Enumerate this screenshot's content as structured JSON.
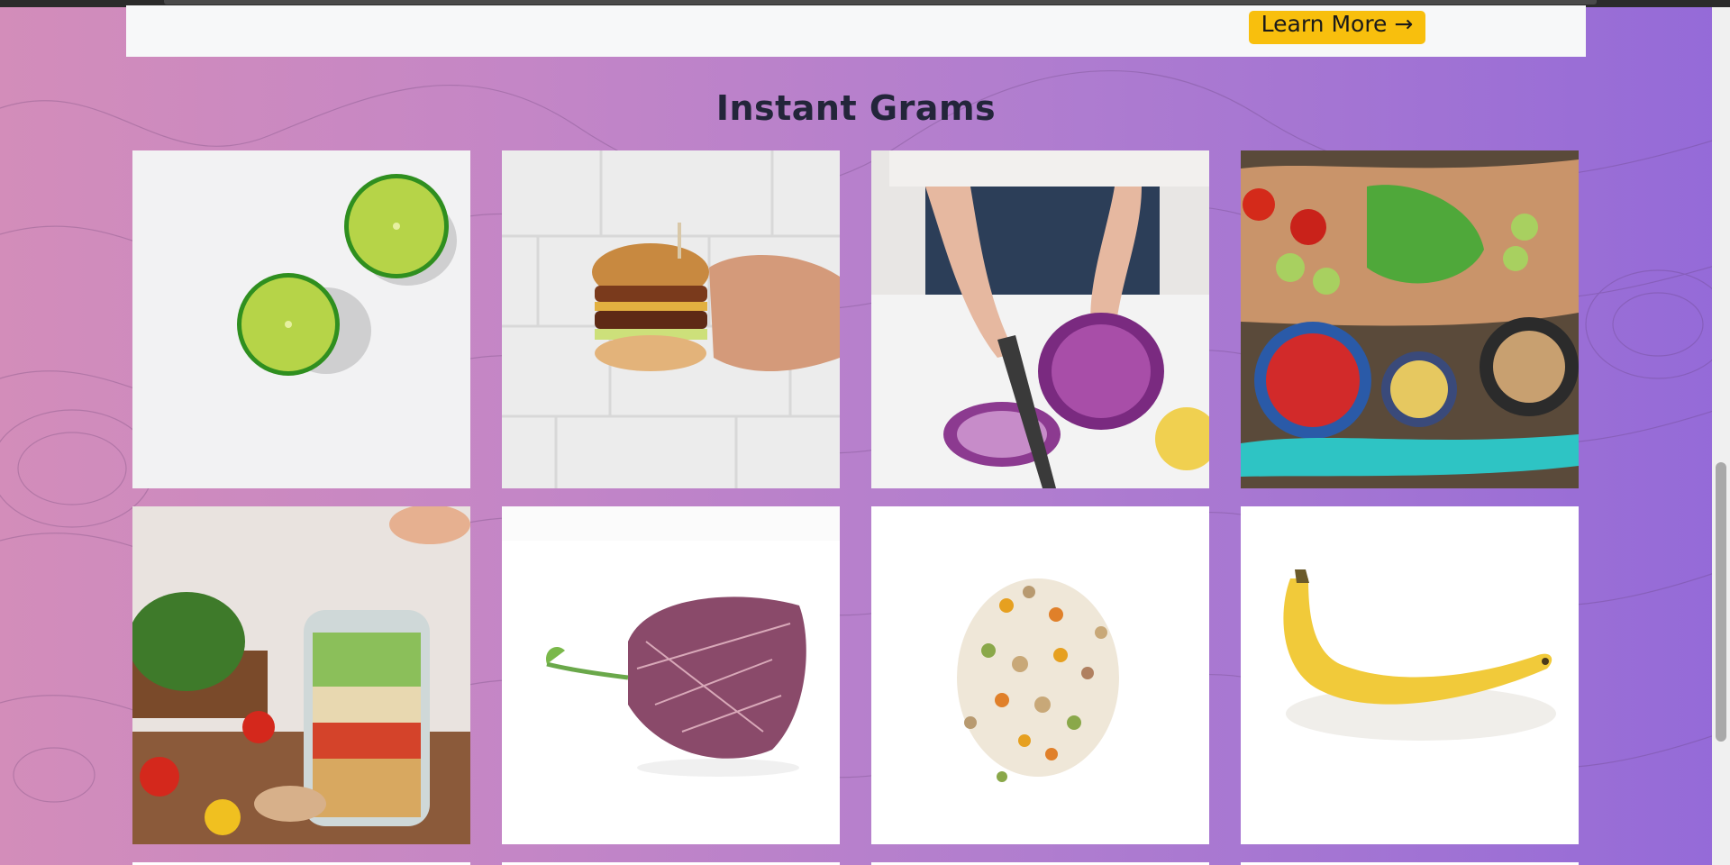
{
  "banner": {
    "cta_label": "Learn More →"
  },
  "gallery": {
    "title": "Instant Grams",
    "images": [
      "two-lime-halves",
      "burger-in-hand",
      "cutting-red-cabbage",
      "vegetables-on-wooden-board",
      "salad-in-mason-jar",
      "purple-leaf",
      "mixed-legumes",
      "banana"
    ]
  },
  "colors": {
    "accent_button": "#f8bf0d",
    "heading_text": "#23253a",
    "gradient_start": "#d38dba",
    "gradient_end": "#946ad8"
  }
}
